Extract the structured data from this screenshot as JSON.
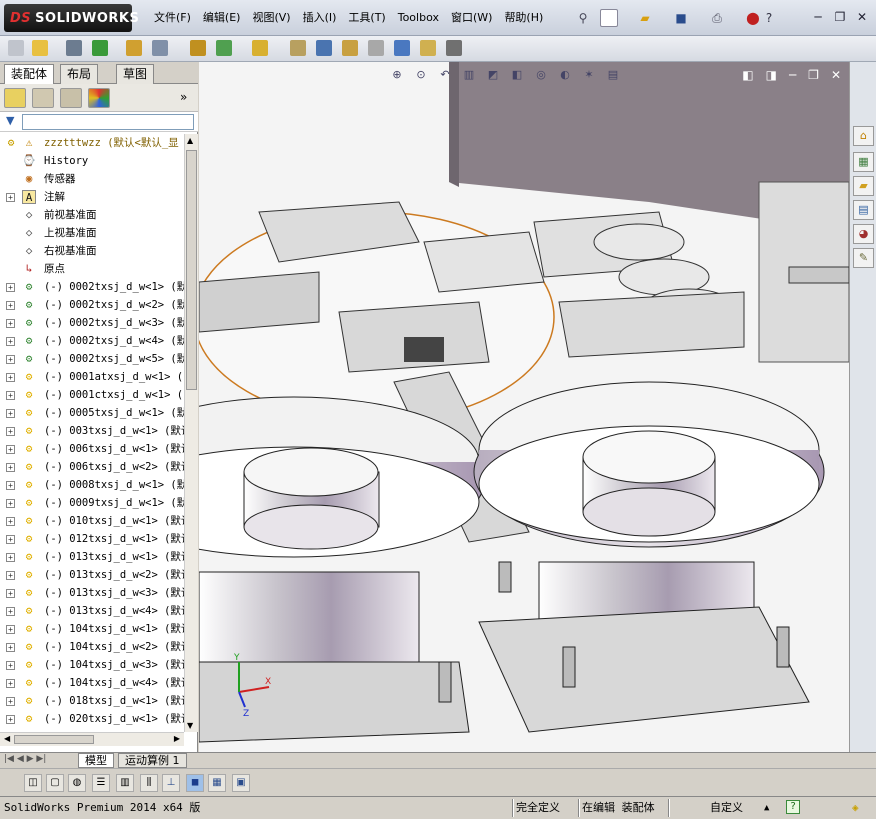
{
  "app": {
    "logo_text": "SOLIDWORKS",
    "logo_ds": "DS"
  },
  "menu": [
    "文件(F)",
    "编辑(E)",
    "视图(V)",
    "插入(I)",
    "工具(T)",
    "Toolbox",
    "窗口(W)",
    "帮助(H)"
  ],
  "panel_tabs": [
    "装配体",
    "布局",
    "草图"
  ],
  "tree": {
    "root": "zzztttwzz  (默认<默认_显",
    "fixed_items": [
      "History",
      "传感器",
      "注解",
      "前视基准面",
      "上视基准面",
      "右视基准面",
      "原点"
    ],
    "components": [
      "(-) 0002txsj_d_w<1>  (默",
      "(-) 0002txsj_d_w<2>  (默",
      "(-) 0002txsj_d_w<3>  (默",
      "(-) 0002txsj_d_w<4>  (默",
      "(-) 0002txsj_d_w<5>  (默",
      "(-) 0001atxsj_d_w<1>  (",
      "(-) 0001ctxsj_d_w<1>  (",
      "(-) 0005txsj_d_w<1>  (默",
      "(-) 003txsj_d_w<1>  (默认",
      "(-) 006txsj_d_w<1>  (默认",
      "(-) 006txsj_d_w<2>  (默认",
      "(-) 0008txsj_d_w<1>  (默",
      "(-) 0009txsj_d_w<1>  (默",
      "(-) 010txsj_d_w<1>  (默认",
      "(-) 012txsj_d_w<1>  (默认",
      "(-) 013txsj_d_w<1>  (默认",
      "(-) 013txsj_d_w<2>  (默认",
      "(-) 013txsj_d_w<3>  (默认",
      "(-) 013txsj_d_w<4>  (默认",
      "(-) 104txsj_d_w<1>  (默认",
      "(-) 104txsj_d_w<2>  (默认",
      "(-) 104txsj_d_w<3>  (默认",
      "(-) 104txsj_d_w<4>  (默认",
      "(-) 018txsj_d_w<1>  (默认",
      "(-) 020txsj_d_w<1>  (默认"
    ]
  },
  "bottom_tabs": [
    "模型",
    "运动算例 1"
  ],
  "status": {
    "version": "SolidWorks Premium 2014 x64 版",
    "definition": "完全定义",
    "editing": "在编辑 装配体",
    "units": "自定义"
  },
  "colors": {
    "accent": "#2e5fa8",
    "assembly_icon": "#e0b000",
    "chrome_bg": "#d4d0c8"
  }
}
